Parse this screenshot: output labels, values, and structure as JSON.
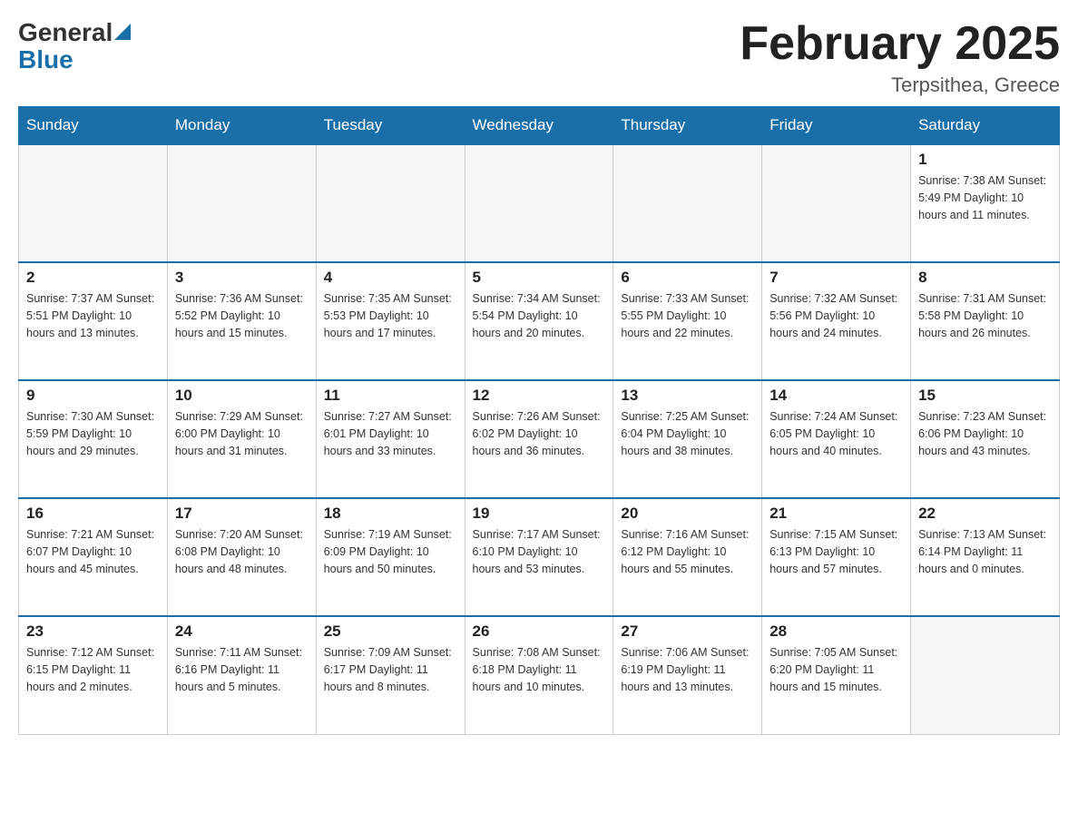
{
  "logo": {
    "general": "General",
    "blue": "Blue"
  },
  "title": {
    "month": "February 2025",
    "location": "Terpsithea, Greece"
  },
  "weekdays": [
    "Sunday",
    "Monday",
    "Tuesday",
    "Wednesday",
    "Thursday",
    "Friday",
    "Saturday"
  ],
  "weeks": [
    [
      {
        "day": "",
        "info": ""
      },
      {
        "day": "",
        "info": ""
      },
      {
        "day": "",
        "info": ""
      },
      {
        "day": "",
        "info": ""
      },
      {
        "day": "",
        "info": ""
      },
      {
        "day": "",
        "info": ""
      },
      {
        "day": "1",
        "info": "Sunrise: 7:38 AM\nSunset: 5:49 PM\nDaylight: 10 hours and 11 minutes."
      }
    ],
    [
      {
        "day": "2",
        "info": "Sunrise: 7:37 AM\nSunset: 5:51 PM\nDaylight: 10 hours and 13 minutes."
      },
      {
        "day": "3",
        "info": "Sunrise: 7:36 AM\nSunset: 5:52 PM\nDaylight: 10 hours and 15 minutes."
      },
      {
        "day": "4",
        "info": "Sunrise: 7:35 AM\nSunset: 5:53 PM\nDaylight: 10 hours and 17 minutes."
      },
      {
        "day": "5",
        "info": "Sunrise: 7:34 AM\nSunset: 5:54 PM\nDaylight: 10 hours and 20 minutes."
      },
      {
        "day": "6",
        "info": "Sunrise: 7:33 AM\nSunset: 5:55 PM\nDaylight: 10 hours and 22 minutes."
      },
      {
        "day": "7",
        "info": "Sunrise: 7:32 AM\nSunset: 5:56 PM\nDaylight: 10 hours and 24 minutes."
      },
      {
        "day": "8",
        "info": "Sunrise: 7:31 AM\nSunset: 5:58 PM\nDaylight: 10 hours and 26 minutes."
      }
    ],
    [
      {
        "day": "9",
        "info": "Sunrise: 7:30 AM\nSunset: 5:59 PM\nDaylight: 10 hours and 29 minutes."
      },
      {
        "day": "10",
        "info": "Sunrise: 7:29 AM\nSunset: 6:00 PM\nDaylight: 10 hours and 31 minutes."
      },
      {
        "day": "11",
        "info": "Sunrise: 7:27 AM\nSunset: 6:01 PM\nDaylight: 10 hours and 33 minutes."
      },
      {
        "day": "12",
        "info": "Sunrise: 7:26 AM\nSunset: 6:02 PM\nDaylight: 10 hours and 36 minutes."
      },
      {
        "day": "13",
        "info": "Sunrise: 7:25 AM\nSunset: 6:04 PM\nDaylight: 10 hours and 38 minutes."
      },
      {
        "day": "14",
        "info": "Sunrise: 7:24 AM\nSunset: 6:05 PM\nDaylight: 10 hours and 40 minutes."
      },
      {
        "day": "15",
        "info": "Sunrise: 7:23 AM\nSunset: 6:06 PM\nDaylight: 10 hours and 43 minutes."
      }
    ],
    [
      {
        "day": "16",
        "info": "Sunrise: 7:21 AM\nSunset: 6:07 PM\nDaylight: 10 hours and 45 minutes."
      },
      {
        "day": "17",
        "info": "Sunrise: 7:20 AM\nSunset: 6:08 PM\nDaylight: 10 hours and 48 minutes."
      },
      {
        "day": "18",
        "info": "Sunrise: 7:19 AM\nSunset: 6:09 PM\nDaylight: 10 hours and 50 minutes."
      },
      {
        "day": "19",
        "info": "Sunrise: 7:17 AM\nSunset: 6:10 PM\nDaylight: 10 hours and 53 minutes."
      },
      {
        "day": "20",
        "info": "Sunrise: 7:16 AM\nSunset: 6:12 PM\nDaylight: 10 hours and 55 minutes."
      },
      {
        "day": "21",
        "info": "Sunrise: 7:15 AM\nSunset: 6:13 PM\nDaylight: 10 hours and 57 minutes."
      },
      {
        "day": "22",
        "info": "Sunrise: 7:13 AM\nSunset: 6:14 PM\nDaylight: 11 hours and 0 minutes."
      }
    ],
    [
      {
        "day": "23",
        "info": "Sunrise: 7:12 AM\nSunset: 6:15 PM\nDaylight: 11 hours and 2 minutes."
      },
      {
        "day": "24",
        "info": "Sunrise: 7:11 AM\nSunset: 6:16 PM\nDaylight: 11 hours and 5 minutes."
      },
      {
        "day": "25",
        "info": "Sunrise: 7:09 AM\nSunset: 6:17 PM\nDaylight: 11 hours and 8 minutes."
      },
      {
        "day": "26",
        "info": "Sunrise: 7:08 AM\nSunset: 6:18 PM\nDaylight: 11 hours and 10 minutes."
      },
      {
        "day": "27",
        "info": "Sunrise: 7:06 AM\nSunset: 6:19 PM\nDaylight: 11 hours and 13 minutes."
      },
      {
        "day": "28",
        "info": "Sunrise: 7:05 AM\nSunset: 6:20 PM\nDaylight: 11 hours and 15 minutes."
      },
      {
        "day": "",
        "info": ""
      }
    ]
  ]
}
